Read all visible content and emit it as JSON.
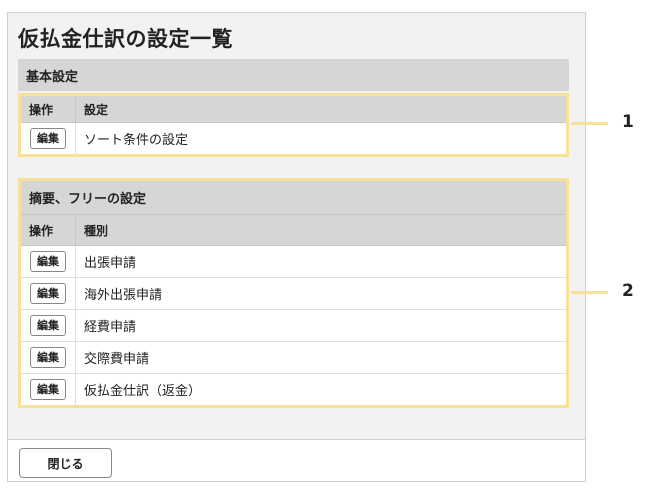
{
  "title": "仮払金仕訳の設定一覧",
  "basic_section": {
    "header": "基本設定",
    "columns": {
      "op": "操作",
      "main": "設定"
    },
    "rows": [
      {
        "button": "編集",
        "label": "ソート条件の設定"
      }
    ]
  },
  "summary_section": {
    "header": "摘要、フリーの設定",
    "columns": {
      "op": "操作",
      "main": "種別"
    },
    "rows": [
      {
        "button": "編集",
        "label": "出張申請"
      },
      {
        "button": "編集",
        "label": "海外出張申請"
      },
      {
        "button": "編集",
        "label": "経費申請"
      },
      {
        "button": "編集",
        "label": "交際費申請"
      },
      {
        "button": "編集",
        "label": "仮払金仕訳（返金）"
      }
    ]
  },
  "footer": {
    "close_label": "閉じる"
  },
  "callouts": [
    "1",
    "2"
  ],
  "colors": {
    "highlight": "#f7e196",
    "header_bg": "#d6d6d6",
    "panel_bg": "#f2f2f2"
  }
}
